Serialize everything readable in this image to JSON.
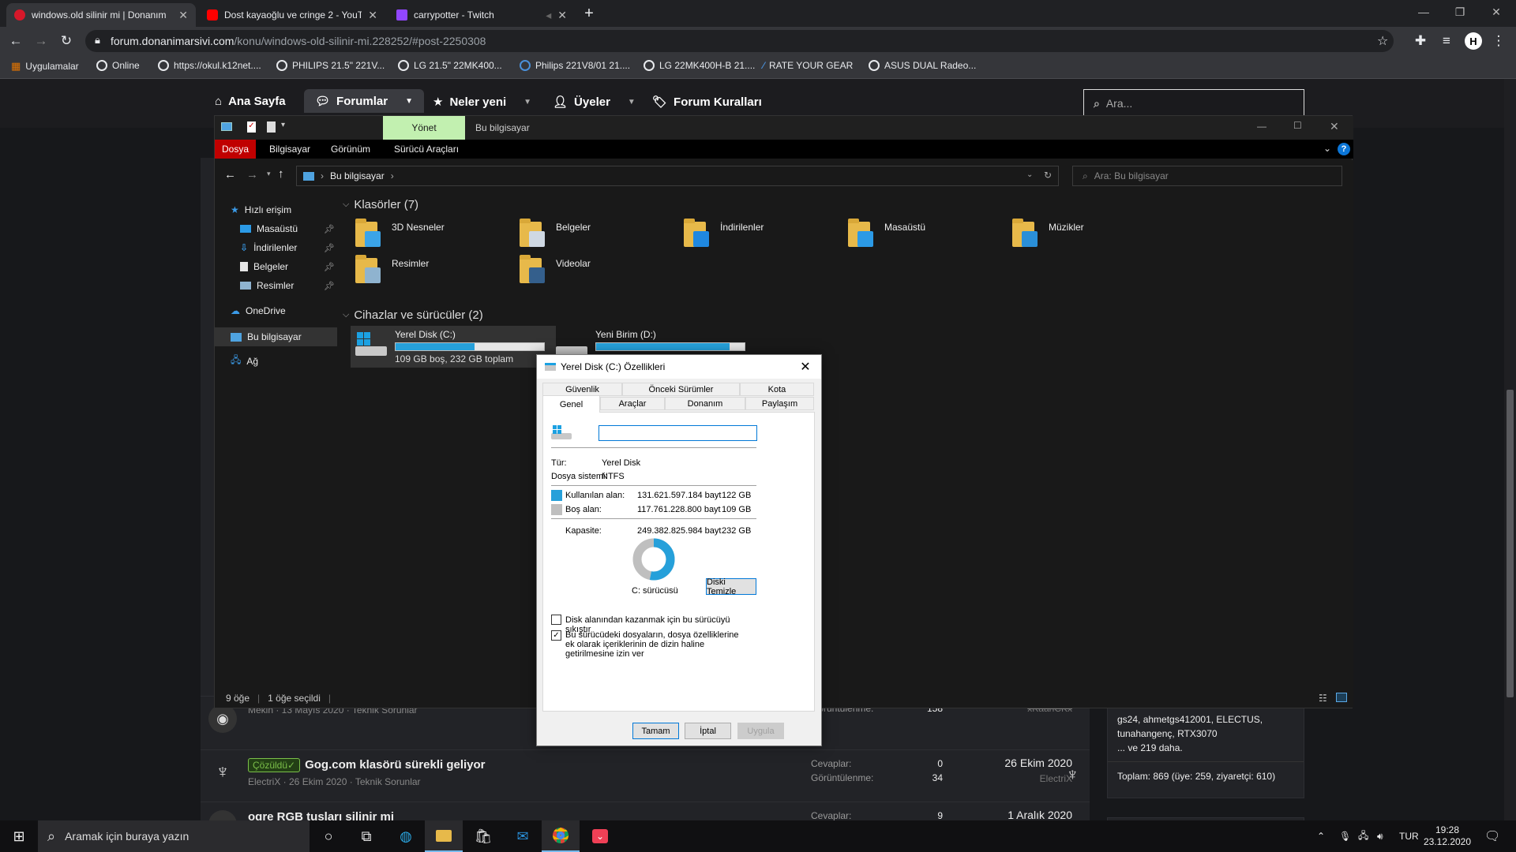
{
  "browser": {
    "tabs": [
      {
        "title": "windows.old silinir mi | Donanım",
        "favicon_color": "#d7182a"
      },
      {
        "title": "Dost kayaoğlu ve cringe 2 - YouT",
        "favicon_color": "#ff0000"
      },
      {
        "title": "carrypotter - Twitch",
        "favicon_color": "#9146ff"
      }
    ],
    "url_domain": "forum.donanimarsivi.com",
    "url_path": "/konu/windows-old-silinir-mi.228252/#post-2250308",
    "profile_initial": "H",
    "bookmarks": [
      "Uygulamalar",
      "Online",
      "https://okul.k12net....",
      "PHILIPS 21.5\" 221V...",
      "LG 21.5\" 22MK400...",
      "Philips 221V8/01 21....",
      "LG 22MK400H-B 21....",
      "RATE YOUR GEAR",
      "ASUS DUAL Radeo..."
    ]
  },
  "forum": {
    "nav": [
      "Ana Sayfa",
      "Forumlar",
      "Neler yeni",
      "Üyeler",
      "Forum Kuralları"
    ],
    "search_placeholder": "Ara...",
    "threads": [
      {
        "meta": "Mekin · 13 Mayıs 2020 · Teknik Sorunlar",
        "stat2_label": "Görüntülenme:",
        "stat2_value": "158",
        "author": "xKaanCKx"
      },
      {
        "badge": "Çözüldü✓",
        "title": "Gog.com klasörü sürekli geliyor",
        "meta": "ElectriX · 26 Ekim 2020 · Teknik Sorunlar",
        "stat1_label": "Cevaplar:",
        "stat1_value": "0",
        "stat2_label": "Görüntülenme:",
        "stat2_value": "34",
        "date": "26 Ekim 2020",
        "author": "ElectriX"
      },
      {
        "title": "ogre RGB tuşları silinir mi",
        "stat1_label": "Cevaplar:",
        "stat1_value": "9",
        "date": "1 Aralık 2020"
      }
    ],
    "online_members": "gs24, ahmetgs412001, ELECTUS, tunahangenç, RTX3070",
    "online_more": "... ve 219 daha.",
    "online_total": "Toplam: 869 (üye: 259, ziyaretçi: 610)"
  },
  "explorer": {
    "manage_tab": "Yönet",
    "window_title": "Bu bilgisayar",
    "ribbon_tabs": [
      "Dosya",
      "Bilgisayar",
      "Görünüm",
      "Sürücü Araçları"
    ],
    "address": "Bu bilgisayar",
    "search_placeholder": "Ara: Bu bilgisayar",
    "nav_pane": {
      "quick_access": "Hızlı erişim",
      "pinned": [
        "Masaüstü",
        "İndirilenler",
        "Belgeler",
        "Resimler"
      ],
      "onedrive": "OneDrive",
      "this_pc": "Bu bilgisayar",
      "network": "Ağ"
    },
    "folders_group": "Klasörler (7)",
    "folders": [
      {
        "name": "3D Nesneler",
        "overlay": "#3ba4e8"
      },
      {
        "name": "Belgeler",
        "overlay": "#cfd8e3"
      },
      {
        "name": "İndirilenler",
        "overlay": "#1f88e0"
      },
      {
        "name": "Masaüstü",
        "overlay": "#2b9ae6"
      },
      {
        "name": "Müzikler",
        "overlay": "#2a8fd8"
      },
      {
        "name": "Resimler",
        "overlay": "#8fb3cf"
      },
      {
        "name": "Videolar",
        "overlay": "#345f8c"
      }
    ],
    "devices_group": "Cihazlar ve sürücüler (2)",
    "drives": [
      {
        "name": "Yerel Disk (C:)",
        "used_fraction": 0.53,
        "detail": "109 GB boş, 232 GB toplam"
      },
      {
        "name": "Yeni Birim (D:)",
        "used_fraction": 0.9,
        "detail": ""
      }
    ],
    "status_items": "9 öğe",
    "status_selected": "1 öğe seçildi"
  },
  "dialog": {
    "title": "Yerel Disk (C:) Özellikleri",
    "tabs_top": [
      "Güvenlik",
      "Önceki Sürümler",
      "Kota"
    ],
    "tabs_bottom": [
      "Genel",
      "Araçlar",
      "Donanım",
      "Paylaşım"
    ],
    "label_value": "",
    "type_label": "Tür:",
    "type_value": "Yerel Disk",
    "fs_label": "Dosya sistemi:",
    "fs_value": "NTFS",
    "used_label": "Kullanılan alan:",
    "used_bytes": "131.621.597.184 bayt",
    "used_gb": "122 GB",
    "free_label": "Boş alan:",
    "free_bytes": "117.761.228.800 bayt",
    "free_gb": "109 GB",
    "cap_label": "Kapasite:",
    "cap_bytes": "249.382.825.984 bayt",
    "cap_gb": "232 GB",
    "used_fraction": 0.53,
    "drive_label": "C: sürücüsü",
    "cleanup_button": "Diski Temizle",
    "compress_label": "Disk alanından kazanmak için bu sürücüyü sıkıştır",
    "index_label": "Bu sürücüdeki dosyaların, dosya özelliklerine ek olarak içeriklerinin de dizin haline getirilmesine izin ver",
    "compress_checked": false,
    "index_checked": true,
    "ok": "Tamam",
    "cancel": "İptal",
    "apply": "Uygula",
    "used_color": "#26a0da",
    "free_color": "#bfbfbf"
  },
  "taskbar": {
    "search_placeholder": "Aramak için buraya yazın",
    "lang": "TUR",
    "time": "19:28",
    "date": "23.12.2020"
  }
}
